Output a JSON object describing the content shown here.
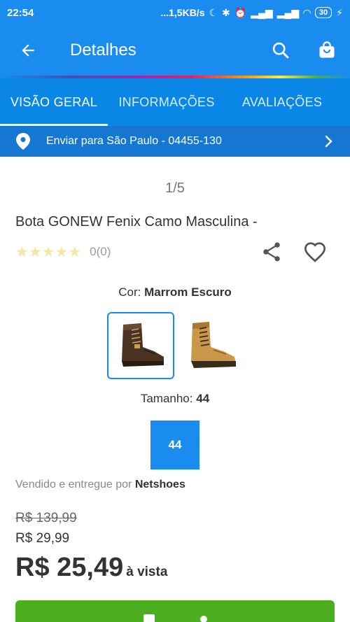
{
  "status_bar": {
    "time": "22:54",
    "network": "...1,5KB/s",
    "battery": "30"
  },
  "app_bar": {
    "title": "Detalhes",
    "icons": [
      "arrow-back-icon",
      "search-icon",
      "shopping-bag-icon"
    ]
  },
  "tabs": [
    {
      "label": "VISÃO GERAL",
      "active": true
    },
    {
      "label": "INFORMAÇÕES",
      "active": false
    },
    {
      "label": "AVALIAÇÕES",
      "active": false
    }
  ],
  "shipping": {
    "label": "Enviar para São Paulo - 04455-130"
  },
  "gallery": {
    "counter": "1/5"
  },
  "product": {
    "name": "Bota GONEW Fenix Camo Masculina -",
    "stars": "★★★★★",
    "review_count": "0(0)"
  },
  "color": {
    "label": "Cor:",
    "value": "Marrom Escuro"
  },
  "size": {
    "label": "Tamanho:",
    "value": "44",
    "option": "44"
  },
  "seller": {
    "prefix": "Vendido e entregue por",
    "name": "Netshoes"
  },
  "price": {
    "old": "R$ 139,99",
    "mid": "R$ 29,99",
    "main": "R$ 25,49",
    "suffix": "à vista"
  },
  "colors": {
    "primary": "#1a8cf0",
    "buy": "#4caf1f"
  }
}
